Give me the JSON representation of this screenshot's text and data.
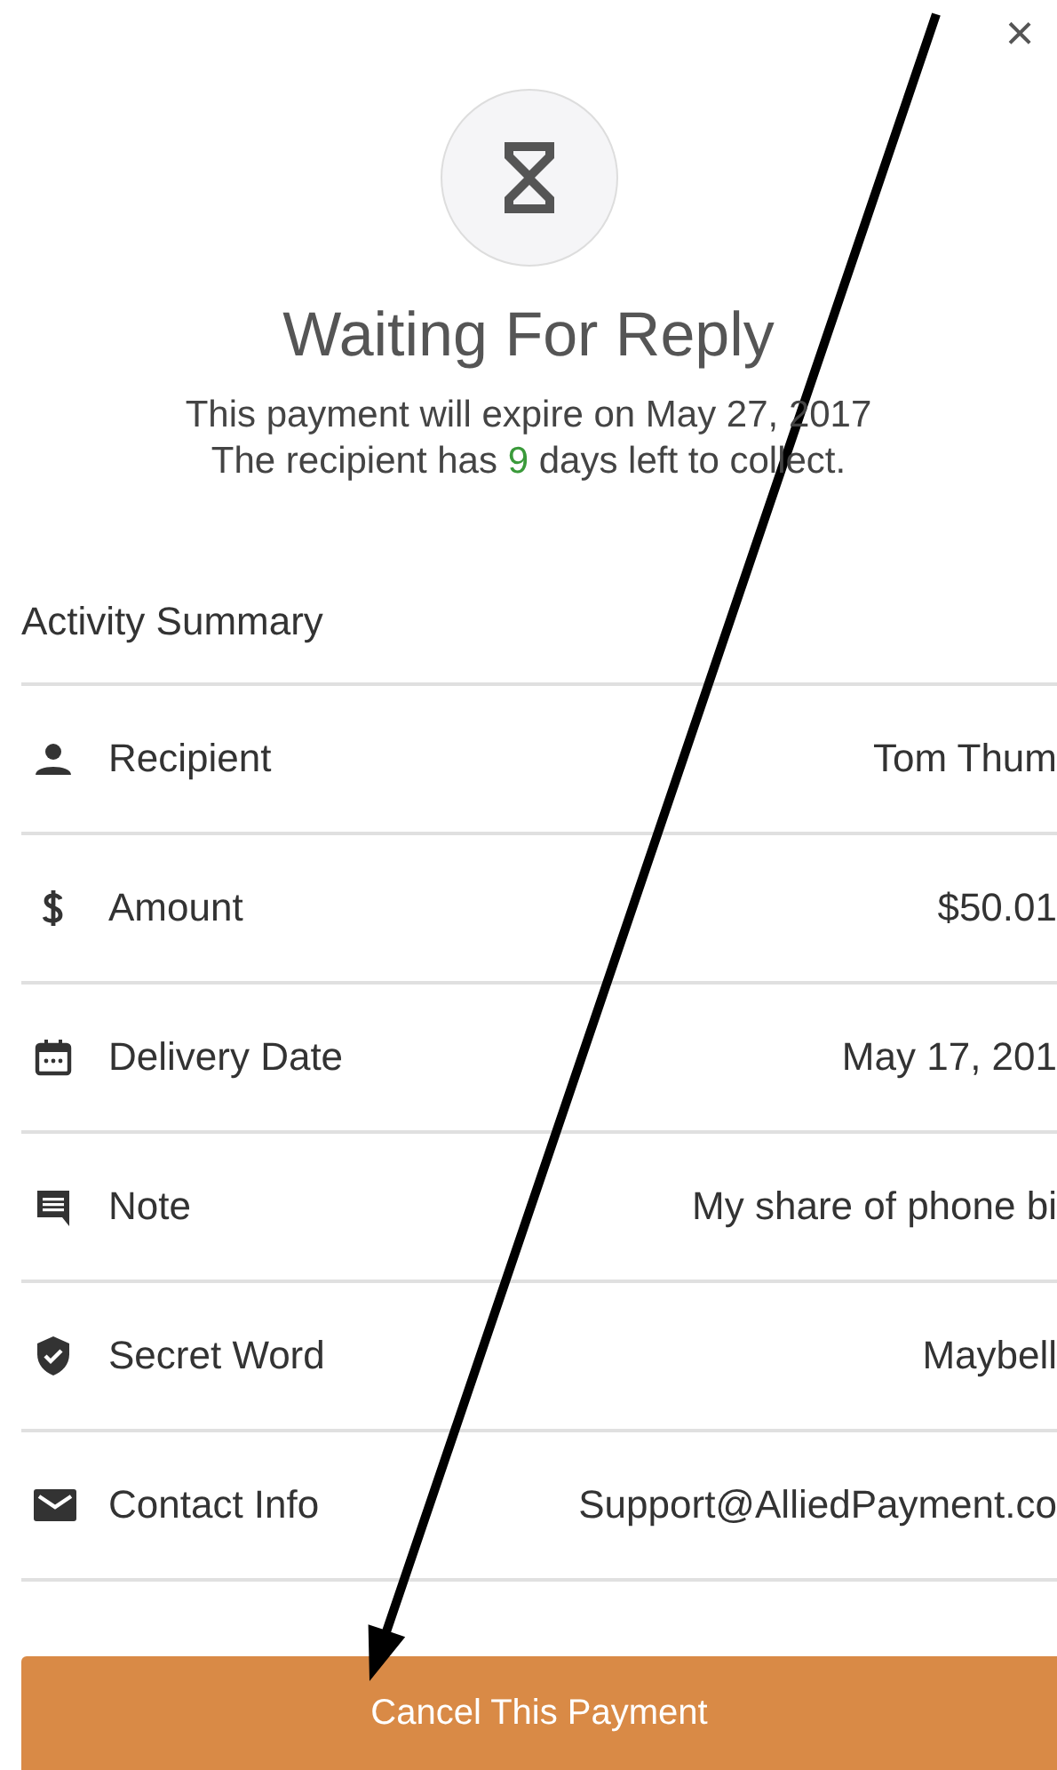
{
  "close_button": {
    "label": "×"
  },
  "title": "Waiting For Reply",
  "expiry_text": "This payment will expire on May 27, 2017",
  "days_left": {
    "before": "The recipient has",
    "count": "9",
    "after": "days left to collect."
  },
  "section_title": "Activity Summary",
  "rows": [
    {
      "kind": "person",
      "label": "Recipient",
      "value": "Tom Thum"
    },
    {
      "kind": "dollar",
      "label": "Amount",
      "value": "$50.01"
    },
    {
      "kind": "calendar",
      "label": "Delivery Date",
      "value": "May 17, 201"
    },
    {
      "kind": "note",
      "label": "Note",
      "value": "My share of phone bi"
    },
    {
      "kind": "shield",
      "label": "Secret Word",
      "value": "Maybell"
    },
    {
      "kind": "mail",
      "label": "Contact Info",
      "value": "Support@AlliedPayment.co"
    }
  ],
  "cancel_button": {
    "label": "Cancel This Payment"
  }
}
